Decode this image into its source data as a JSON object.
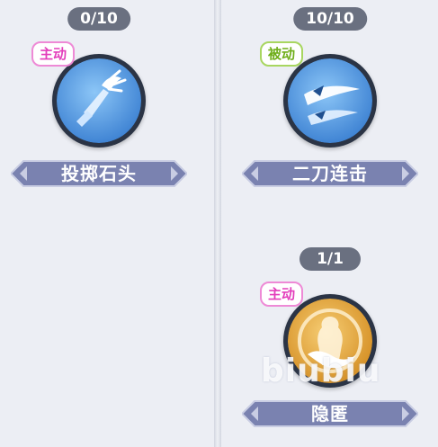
{
  "skills": [
    {
      "level": "0/10",
      "type": "主动",
      "name": "投掷石头",
      "icon": "throw-stone-icon",
      "color": "#5b9ce0"
    },
    {
      "level": "10/10",
      "type": "被动",
      "name": "二刀连击",
      "icon": "twin-blade-icon",
      "color": "#5b9ce0"
    },
    {
      "level": "1/1",
      "type": "主动",
      "name": "隐匿",
      "icon": "stealth-icon",
      "color": "#e0a23a"
    }
  ],
  "watermark": "biubiu",
  "colors": {
    "active_badge": "#e33dbb",
    "passive_badge": "#6fae1a",
    "name_plate": "#7a82b0",
    "level_pill": "#6a7080"
  }
}
